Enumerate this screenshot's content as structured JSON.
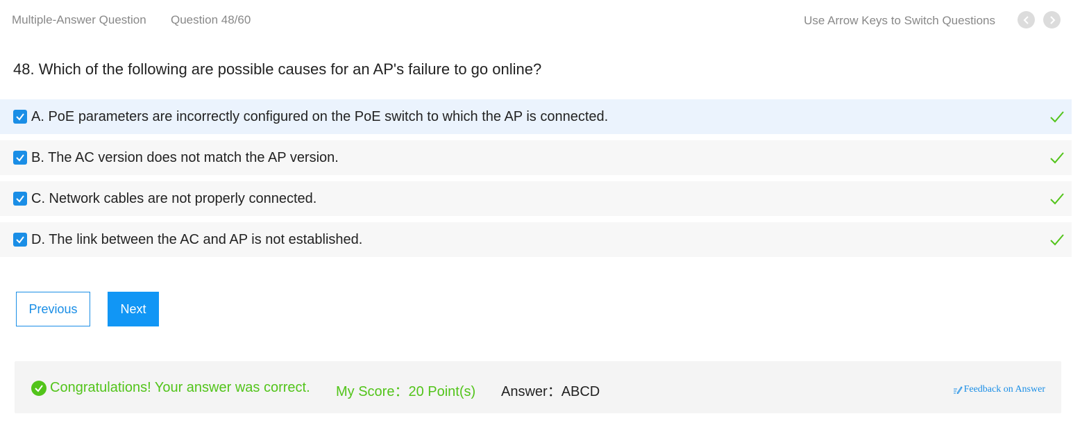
{
  "header": {
    "question_type": "Multiple-Answer Question",
    "question_count": "Question 48/60",
    "hint": "Use Arrow Keys to Switch Questions",
    "prev_icon": "chevron-left-icon",
    "next_icon": "chevron-right-icon"
  },
  "question": {
    "text": "48. Which of the following are possible causes for an AP's failure to go online?"
  },
  "options": [
    {
      "label": "A. PoE parameters are incorrectly configured on the PoE switch to which the AP is connected.",
      "checked": true,
      "correct": true
    },
    {
      "label": "B. The AC version does not match the AP version.",
      "checked": true,
      "correct": true
    },
    {
      "label": "C. Network cables are not properly connected.",
      "checked": true,
      "correct": true
    },
    {
      "label": "D. The link between the AC and AP is not established.",
      "checked": true,
      "correct": true
    }
  ],
  "buttons": {
    "previous": "Previous",
    "next": "Next"
  },
  "result": {
    "message": "Congratulations! Your answer was correct.",
    "score": "My Score：20 Point(s)",
    "answer": "Answer：ABCD",
    "feedback": "Feedback on Answer"
  },
  "colors": {
    "accent": "#1a8ee6",
    "success": "#52c41a",
    "selected_row": "#ebf3fd"
  }
}
